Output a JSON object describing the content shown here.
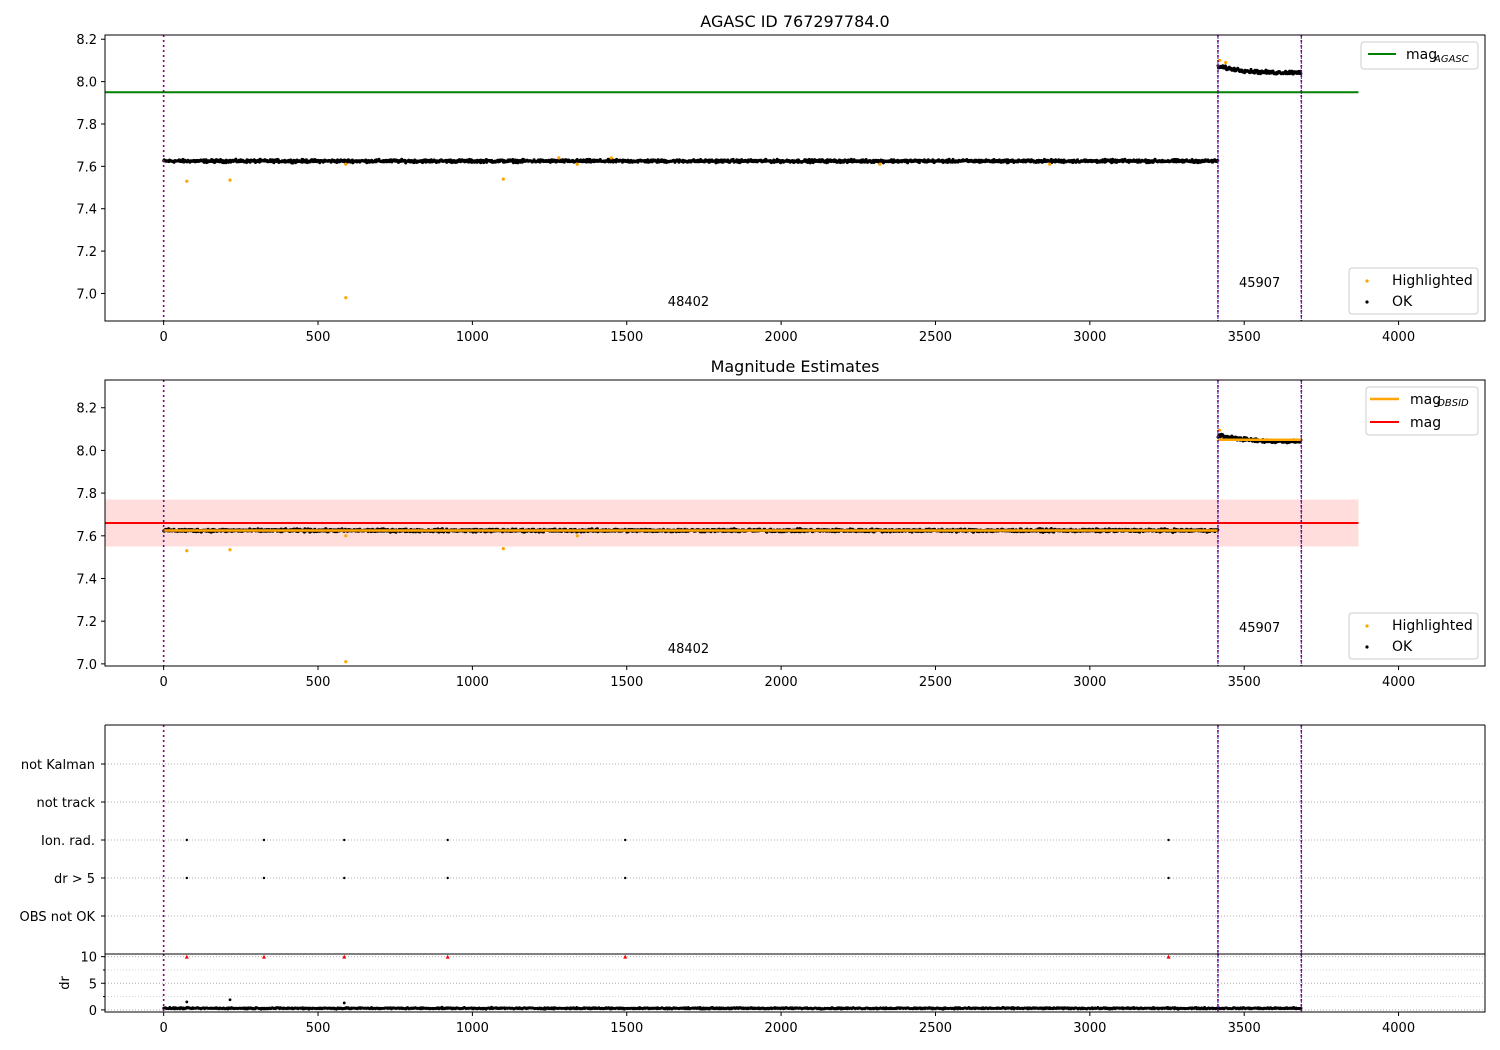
{
  "chart_data": [
    {
      "type": "scatter",
      "title": "AGASC ID 767297784.0",
      "xlim": [
        -190,
        4280
      ],
      "ylim": [
        6.87,
        8.22
      ],
      "xticks": [
        "0",
        "500",
        "1000",
        "1500",
        "2000",
        "2500",
        "3000",
        "3500",
        "4000"
      ],
      "yticks": [
        "7.0",
        "7.2",
        "7.4",
        "7.6",
        "7.8",
        "8.0",
        "8.2"
      ],
      "reference_lines": [
        {
          "name": "mag_AGASC",
          "y": 7.95,
          "x_range": [
            -190,
            3870
          ],
          "color": "#008000"
        }
      ],
      "segments": [
        {
          "obsid": "48402",
          "x_range": [
            0,
            3415
          ],
          "mean": 7.625,
          "scatter": 0.006
        },
        {
          "obsid": "45907",
          "x_range": [
            3415,
            3685
          ],
          "start": 8.07,
          "end": 8.045,
          "dip": 8.04,
          "scatter": 0.007
        }
      ],
      "highlighted_points": [
        {
          "x": 75,
          "y": 7.53
        },
        {
          "x": 215,
          "y": 7.535
        },
        {
          "x": 590,
          "y": 6.98
        },
        {
          "x": 1100,
          "y": 7.54
        },
        {
          "x": 590,
          "y": 7.61
        },
        {
          "x": 1340,
          "y": 7.61
        },
        {
          "x": 1280,
          "y": 7.64
        },
        {
          "x": 1450,
          "y": 7.64
        },
        {
          "x": 2320,
          "y": 7.61
        },
        {
          "x": 2870,
          "y": 7.61
        },
        {
          "x": 3420,
          "y": 8.1
        },
        {
          "x": 3440,
          "y": 8.09
        }
      ],
      "obsid_boundaries": [
        0,
        3415,
        3685
      ],
      "segment_labels": [
        {
          "text": "48402",
          "x": 1700,
          "y": 6.94
        },
        {
          "text": "45907",
          "x": 3550,
          "y": 7.03
        }
      ],
      "legend_upper": [
        "mag",
        "AGASC"
      ],
      "legend_lower": [
        "Highlighted",
        "OK"
      ],
      "colors": {
        "ok": "#000000",
        "highlighted": "#FFA500",
        "mag_agasc": "#008000",
        "boundary": "#800080",
        "boundary2": "#0000cc"
      }
    },
    {
      "type": "scatter",
      "title": "Magnitude Estimates",
      "xlim": [
        -190,
        4280
      ],
      "ylim": [
        6.99,
        8.33
      ],
      "xticks": [
        "0",
        "500",
        "1000",
        "1500",
        "2000",
        "2500",
        "3000",
        "3500",
        "4000"
      ],
      "yticks": [
        "7.0",
        "7.2",
        "7.4",
        "7.6",
        "7.8",
        "8.0",
        "8.2"
      ],
      "mag": {
        "y": 7.66,
        "band": [
          7.55,
          7.77
        ],
        "x_range": [
          -190,
          3870
        ],
        "color": "#ff0000",
        "band_color": "#ffdddd"
      },
      "mag_obsid": [
        {
          "x_range": [
            0,
            3415
          ],
          "y": 7.625
        },
        {
          "x_range": [
            3415,
            3685
          ],
          "y": 8.05
        }
      ],
      "segments": [
        {
          "obsid": "48402",
          "x_range": [
            0,
            3415
          ],
          "mean": 7.625,
          "scatter": 0.006
        },
        {
          "obsid": "45907",
          "x_range": [
            3415,
            3685
          ],
          "start": 8.07,
          "end": 8.045,
          "dip": 8.04,
          "scatter": 0.007
        }
      ],
      "highlighted_points": [
        {
          "x": 75,
          "y": 7.53
        },
        {
          "x": 215,
          "y": 7.535
        },
        {
          "x": 590,
          "y": 7.01
        },
        {
          "x": 1100,
          "y": 7.54
        },
        {
          "x": 590,
          "y": 7.6
        },
        {
          "x": 1340,
          "y": 7.6
        },
        {
          "x": 3420,
          "y": 8.095
        }
      ],
      "obsid_boundaries": [
        0,
        3415,
        3685
      ],
      "segment_labels": [
        {
          "text": "48402",
          "x": 1700,
          "y": 7.05
        },
        {
          "text": "45907",
          "x": 3550,
          "y": 7.15
        }
      ],
      "legend_upper": [
        [
          "mag",
          "OBSID"
        ],
        [
          "mag",
          ""
        ]
      ],
      "legend_lower": [
        "Highlighted",
        "OK"
      ],
      "colors": {
        "ok": "#000000",
        "highlighted": "#FFA500",
        "mag_obsid": "#FFA500"
      }
    },
    {
      "type": "scatter",
      "title": "",
      "xlim": [
        -190,
        4280
      ],
      "xticks": [
        "0",
        "500",
        "1000",
        "1500",
        "2000",
        "2500",
        "3000",
        "3500",
        "4000"
      ],
      "flag_rows": [
        "not Kalman",
        "not track",
        "Ion. rad.",
        "dr > 5",
        "OBS not OK"
      ],
      "flag_events": [
        {
          "row": "Ion. rad.",
          "x": [
            75,
            325,
            585,
            920,
            1495,
            3255
          ]
        },
        {
          "row": "dr > 5",
          "x": [
            75,
            325,
            585,
            920,
            1495,
            3255
          ]
        }
      ],
      "obsid_boundaries": [
        0,
        3415,
        3685
      ]
    },
    {
      "type": "scatter",
      "title": "",
      "ylabel": "dr",
      "ylim": [
        -0.4,
        10.5
      ],
      "yticks": [
        "0",
        "5",
        "10"
      ],
      "xticks": [
        "0",
        "500",
        "1000",
        "1500",
        "2000",
        "2500",
        "3000",
        "3500",
        "4000"
      ],
      "dr_baseline": {
        "x_range": [
          0,
          3685
        ],
        "mean": 0.3,
        "scatter": 0.12
      },
      "dr_points": [
        {
          "x": 75,
          "y": 1.5
        },
        {
          "x": 215,
          "y": 1.9
        },
        {
          "x": 585,
          "y": 1.3
        }
      ],
      "dr_capped": {
        "y": 10,
        "x": [
          75,
          325,
          585,
          920,
          1495,
          3255
        ],
        "color": "#ff0000"
      },
      "obsid_boundaries": [
        0,
        3415,
        3685
      ]
    }
  ]
}
